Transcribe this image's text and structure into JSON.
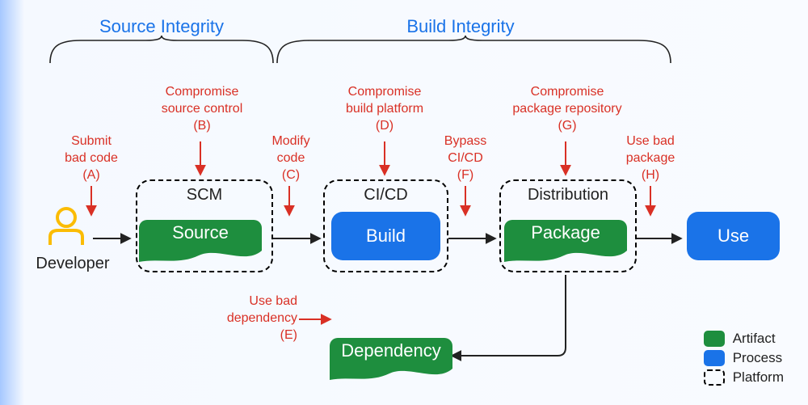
{
  "sections": {
    "source_integrity": "Source Integrity",
    "build_integrity": "Build Integrity"
  },
  "actors": {
    "developer": "Developer"
  },
  "platforms": {
    "scm": "SCM",
    "cicd": "CI/CD",
    "distribution": "Distribution"
  },
  "nodes": {
    "source": "Source",
    "build": "Build",
    "package": "Package",
    "use": "Use",
    "dependency": "Dependency"
  },
  "threats": {
    "a": {
      "text": "Submit\nbad code",
      "tag": "(A)"
    },
    "b": {
      "text": "Compromise\nsource control",
      "tag": "(B)"
    },
    "c": {
      "text": "Modify\ncode",
      "tag": "(C)"
    },
    "d": {
      "text": "Compromise\nbuild platform",
      "tag": "(D)"
    },
    "e": {
      "text": "Use bad\ndependency",
      "tag": "(E)"
    },
    "f": {
      "text": "Bypass\nCI/CD",
      "tag": "(F)"
    },
    "g": {
      "text": "Compromise\npackage repository",
      "tag": "(G)"
    },
    "h": {
      "text": "Use bad\npackage",
      "tag": "(H)"
    }
  },
  "legend": {
    "artifact": "Artifact",
    "process": "Process",
    "platform": "Platform"
  },
  "chart_data": {
    "type": "flow-diagram",
    "title": "Supply-chain integrity threat model (SLSA)",
    "integrity_zones": [
      {
        "name": "Source Integrity",
        "covers": [
          "Developer",
          "Source"
        ]
      },
      {
        "name": "Build Integrity",
        "covers": [
          "Build",
          "Package",
          "Use",
          "Dependency"
        ]
      }
    ],
    "nodes": [
      {
        "id": "developer",
        "label": "Developer",
        "kind": "actor"
      },
      {
        "id": "source",
        "label": "Source",
        "kind": "artifact",
        "platform": "SCM"
      },
      {
        "id": "build",
        "label": "Build",
        "kind": "process",
        "platform": "CI/CD"
      },
      {
        "id": "package",
        "label": "Package",
        "kind": "artifact",
        "platform": "Distribution"
      },
      {
        "id": "use",
        "label": "Use",
        "kind": "process"
      },
      {
        "id": "dependency",
        "label": "Dependency",
        "kind": "artifact"
      }
    ],
    "edges": [
      {
        "from": "developer",
        "to": "source"
      },
      {
        "from": "source",
        "to": "build"
      },
      {
        "from": "build",
        "to": "package"
      },
      {
        "from": "package",
        "to": "use"
      },
      {
        "from": "package",
        "to": "dependency"
      },
      {
        "from": "dependency",
        "to": "build",
        "label": "Use bad dependency (E)"
      }
    ],
    "threats": [
      {
        "tag": "A",
        "label": "Submit bad code",
        "targets_edge": [
          "developer",
          "source"
        ]
      },
      {
        "tag": "B",
        "label": "Compromise source control",
        "targets_node": "source"
      },
      {
        "tag": "C",
        "label": "Modify code",
        "targets_edge": [
          "source",
          "build"
        ]
      },
      {
        "tag": "D",
        "label": "Compromise build platform",
        "targets_node": "build"
      },
      {
        "tag": "E",
        "label": "Use bad dependency",
        "targets_edge": [
          "dependency",
          "build"
        ]
      },
      {
        "tag": "F",
        "label": "Bypass CI/CD",
        "targets_edge": [
          "build",
          "package"
        ]
      },
      {
        "tag": "G",
        "label": "Compromise package repository",
        "targets_node": "package"
      },
      {
        "tag": "H",
        "label": "Use bad package",
        "targets_edge": [
          "package",
          "use"
        ]
      }
    ],
    "legend": [
      {
        "color": "#1e8e3e",
        "label": "Artifact"
      },
      {
        "color": "#1a73e8",
        "label": "Process"
      },
      {
        "style": "dashed-border",
        "label": "Platform"
      }
    ]
  }
}
